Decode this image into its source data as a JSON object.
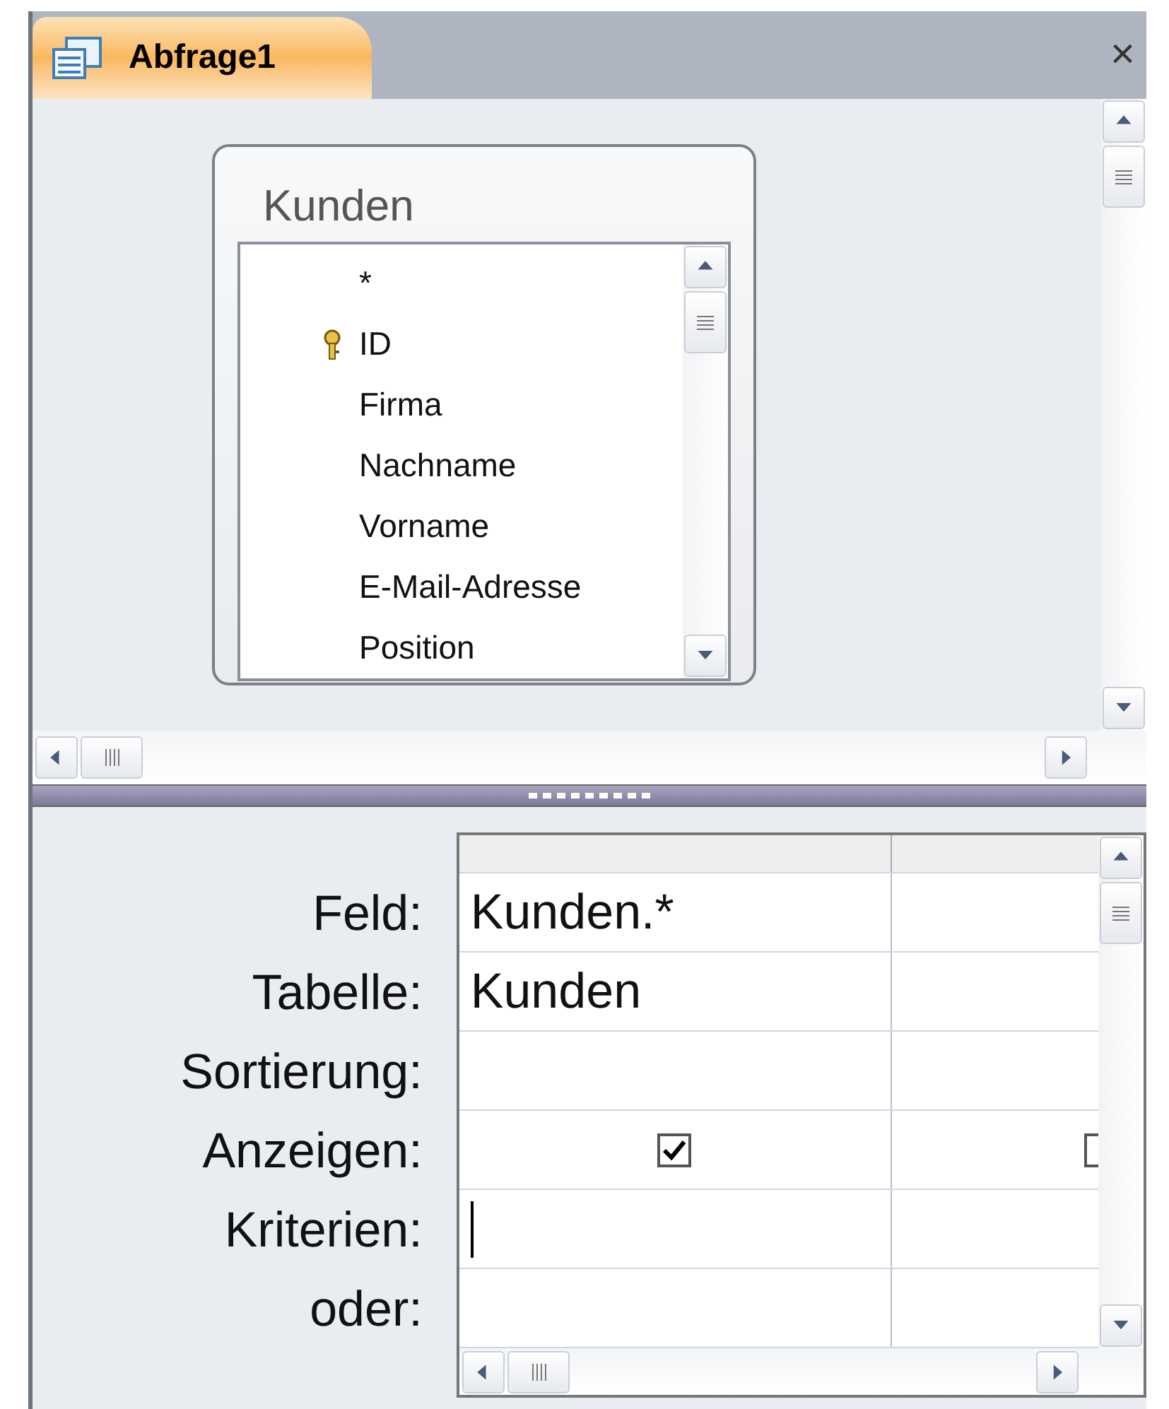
{
  "tab": {
    "title": "Abfrage1",
    "selected": true
  },
  "close_label": "×",
  "table": {
    "title": "Kunden",
    "fields": [
      {
        "name": "*",
        "kind": "plain"
      },
      {
        "name": "ID",
        "kind": "key"
      },
      {
        "name": "Firma",
        "kind": "plain"
      },
      {
        "name": "Nachname",
        "kind": "plain"
      },
      {
        "name": "Vorname",
        "kind": "plain"
      },
      {
        "name": "E-Mail-Adresse",
        "kind": "plain"
      },
      {
        "name": "Position",
        "kind": "plain"
      }
    ]
  },
  "grid": {
    "rows": [
      {
        "label": "Feld:",
        "cells": [
          {
            "kind": "text",
            "value": "Kunden.*"
          },
          {
            "kind": "text"
          }
        ]
      },
      {
        "label": "Tabelle:",
        "cells": [
          {
            "kind": "text",
            "value": "Kunden"
          },
          {
            "kind": "text"
          }
        ]
      },
      {
        "label": "Sortierung:",
        "cells": [
          {
            "kind": "text"
          },
          {
            "kind": "text"
          }
        ]
      },
      {
        "label": "Anzeigen:",
        "cells": [
          {
            "kind": "checkbox",
            "checked": true
          },
          {
            "kind": "checkbox",
            "checked": false
          }
        ]
      },
      {
        "label": "Kriterien:",
        "cells": [
          {
            "kind": "text",
            "caret": true
          },
          {
            "kind": "text"
          }
        ]
      },
      {
        "label": "oder:",
        "cells": [
          {
            "kind": "text"
          },
          {
            "kind": "text"
          }
        ]
      }
    ]
  }
}
